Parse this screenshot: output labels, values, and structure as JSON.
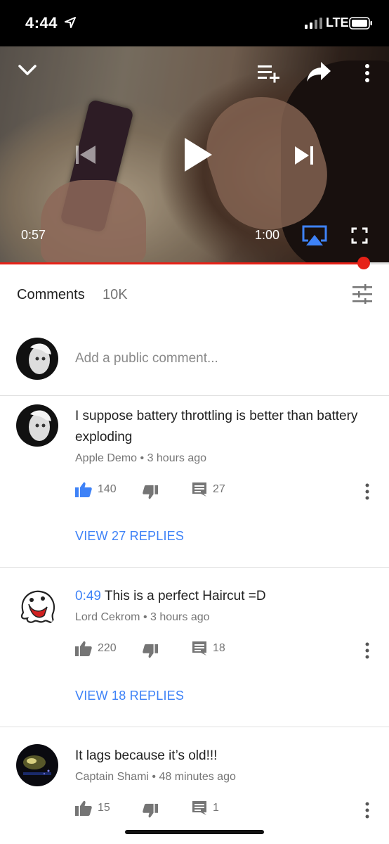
{
  "status_bar": {
    "time": "4:44",
    "network": "LTE"
  },
  "player": {
    "current_time": "0:57",
    "duration": "1:00",
    "progress": 0.935,
    "colors": {
      "progress": "#e62117"
    }
  },
  "comments_header": {
    "title": "Comments",
    "count": "10K"
  },
  "add_comment": {
    "placeholder": "Add a public comment..."
  },
  "comments": [
    {
      "text": "I suppose battery throttling is better than battery exploding",
      "timestamp_link": "",
      "author": "Apple Demo",
      "time": "3 hours ago",
      "likes": "140",
      "replies_count": "27",
      "view_replies": "VIEW 27 REPLIES",
      "liked": true
    },
    {
      "text": "This is a perfect Haircut =D",
      "timestamp_link": "0:49",
      "author": "Lord Cekrom",
      "time": "3 hours ago",
      "likes": "220",
      "replies_count": "18",
      "view_replies": "VIEW 18 REPLIES",
      "liked": false
    },
    {
      "text": "It lags because it’s old!!!",
      "timestamp_link": "",
      "author": "Captain Shami",
      "time": "48 minutes ago",
      "likes": "15",
      "replies_count": "1",
      "view_replies": "",
      "liked": false
    }
  ],
  "meta_separator": "•",
  "icons": {
    "collapse": "chevron-down-icon",
    "add_to_playlist": "playlist-add-icon",
    "share": "share-icon",
    "more": "more-vert-icon",
    "previous": "skip-previous-icon",
    "play": "play-icon",
    "next": "skip-next-icon",
    "airplay": "airplay-icon",
    "fullscreen": "fullscreen-icon",
    "filter": "sort-filter-icon",
    "like": "thumb-up-icon",
    "dislike": "thumb-down-icon",
    "reply": "comment-icon"
  },
  "colors": {
    "accent": "#3e82f7",
    "text": "#212121",
    "secondary": "#757575"
  }
}
